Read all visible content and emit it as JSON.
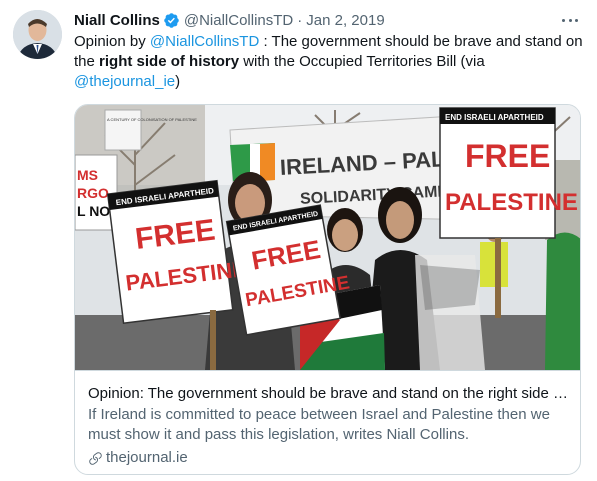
{
  "tweet": {
    "author_name": "Niall Collins",
    "author_handle": "@NiallCollinsTD",
    "separator": "·",
    "date": "Jan 2, 2019",
    "verified": true,
    "avatar_icon": "avatar-photo",
    "more_icon": "more-dots-icon",
    "text_part1": "Opinion by ",
    "text_mention": "@NiallCollinsTD",
    "text_part2": " : The government should be brave and stand on the ",
    "text_bold": "right side of history",
    "text_part3": " with the Occupied Territories Bill  (via ",
    "text_mention2": "@thejournal_ie",
    "text_part4": ")"
  },
  "card": {
    "title": "Opinion: The government should be brave and stand on the right side …",
    "description": "If Ireland is committed to peace between Israel and Palestine then we must show it and pass this legislation, writes Niall Collins.",
    "domain": "thejournal.ie",
    "domain_icon": "link-icon",
    "image": {
      "sign_header": "END ISRAELI APARTHEID",
      "sign_line1": "FREE",
      "sign_line2": "PALESTINE",
      "banner_text": "IRELAND – PALESTINE",
      "banner_text2": "SOLIDARITY CAMPAIGN",
      "left_sign_lines": [
        "MS",
        "RGO",
        "L NOW"
      ],
      "back_sign_text": "A CENTURY OF COLONISATION OF PALESTINE"
    }
  },
  "colors": {
    "link": "#1b95e0",
    "secondary": "#536471",
    "border": "#cfd9de",
    "verified": "#1d9bf0",
    "sign_red": "#d32f2f"
  }
}
